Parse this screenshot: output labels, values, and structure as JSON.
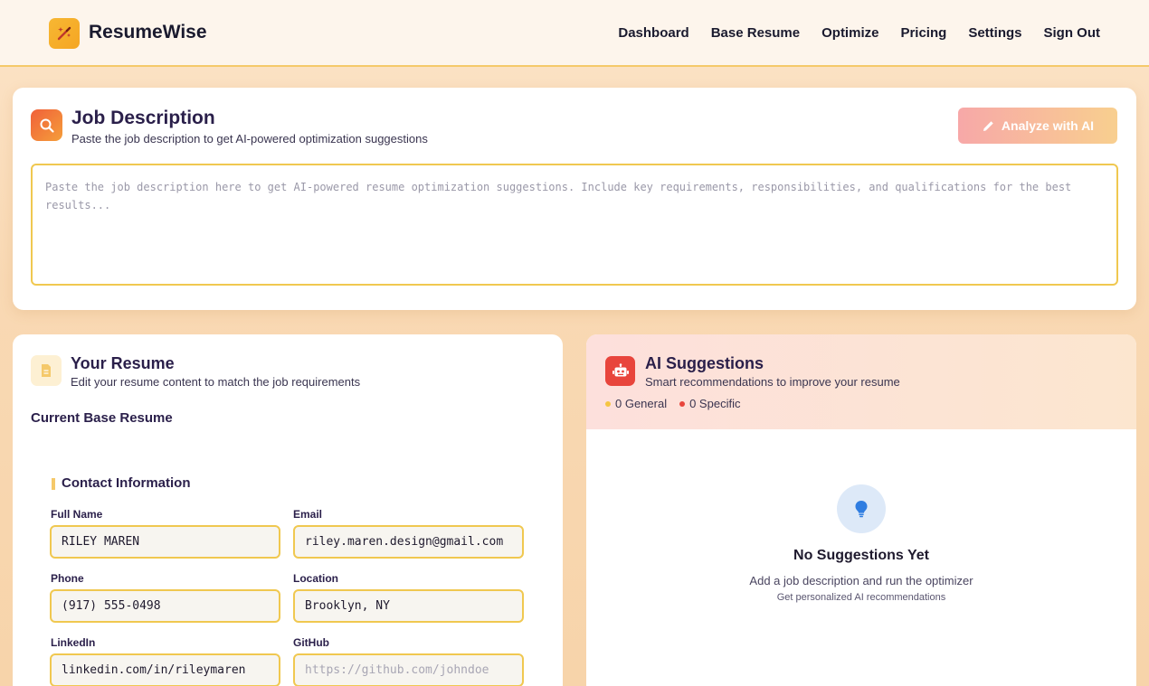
{
  "header": {
    "brand": "ResumeWise",
    "nav": [
      "Dashboard",
      "Base Resume",
      "Optimize",
      "Pricing",
      "Settings",
      "Sign Out"
    ]
  },
  "job_description": {
    "title": "Job Description",
    "subtitle": "Paste the job description to get AI-powered optimization suggestions",
    "analyze_label": "Analyze with AI",
    "placeholder": "Paste the job description here to get AI-powered resume optimization suggestions. Include key requirements, responsibilities, and qualifications for the best results...",
    "value": ""
  },
  "resume": {
    "title": "Your Resume",
    "subtitle": "Edit your resume content to match the job requirements",
    "section_title": "Current Base Resume",
    "contact_title": "Contact Information",
    "fields": {
      "full_name": {
        "label": "Full Name",
        "value": "RILEY MAREN",
        "placeholder": ""
      },
      "email": {
        "label": "Email",
        "value": "riley.maren.design@gmail.com",
        "placeholder": ""
      },
      "phone": {
        "label": "Phone",
        "value": "(917) 555-0498",
        "placeholder": ""
      },
      "location": {
        "label": "Location",
        "value": "Brooklyn, NY",
        "placeholder": ""
      },
      "linkedin": {
        "label": "LinkedIn",
        "value": "linkedin.com/in/rileymaren",
        "placeholder": ""
      },
      "github": {
        "label": "GitHub",
        "value": "",
        "placeholder": "https://github.com/johndoe"
      }
    }
  },
  "ai": {
    "title": "AI Suggestions",
    "subtitle": "Smart recommendations to improve your resume",
    "general_count": "0 General",
    "specific_count": "0 Specific",
    "empty_title": "No Suggestions Yet",
    "empty_subtitle": "Add a job description and run the optimizer",
    "empty_note": "Get personalized AI recommendations"
  },
  "colors": {
    "accent": "#f5c96a",
    "general_dot": "#f5c542",
    "specific_dot": "#e8453c"
  },
  "icons": {
    "logo": "magic-wand-icon",
    "job": "search-icon",
    "analyze": "pencil-icon",
    "resume": "document-icon",
    "ai": "robot-icon",
    "empty": "lightbulb-icon"
  }
}
